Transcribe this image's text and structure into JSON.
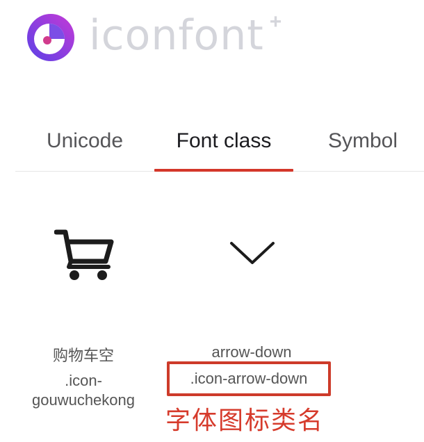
{
  "brand": {
    "name": "iconfont",
    "plus": "+",
    "logo_colors": {
      "outer_start": "#5b41e6",
      "outer_end": "#c53ad6",
      "inner": "#ffffff",
      "accent": "#7c4ee6",
      "dot": "#d13b8d"
    },
    "text_color": "#d4d5db"
  },
  "tabs": [
    {
      "label": "Unicode",
      "active": false
    },
    {
      "label": "Font class",
      "active": true
    },
    {
      "label": "Symbol",
      "active": false
    }
  ],
  "accent_color": "#d4372a",
  "icons": [
    {
      "icon": "shopping-cart-icon",
      "name": "购物车空",
      "class_name_line1": ".icon-",
      "class_name_line2": "gouwuchekong"
    },
    {
      "icon": "chevron-down-icon",
      "name": "arrow-down",
      "class_name": ".icon-arrow-down"
    }
  ],
  "annotation": "字体图标类名"
}
